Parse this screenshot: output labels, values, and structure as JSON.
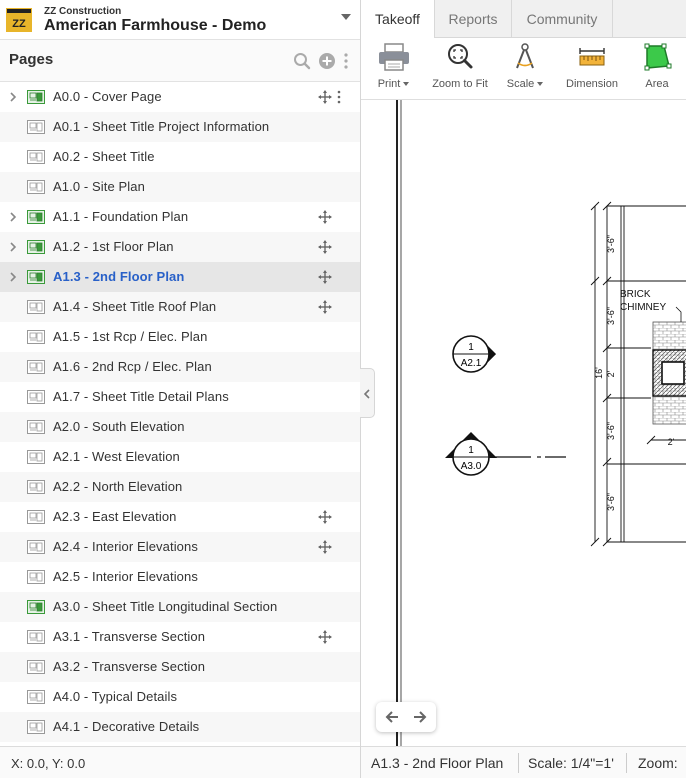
{
  "app": {
    "company": "ZZ Construction",
    "project": "American Farmhouse - Demo"
  },
  "pages_panel": {
    "title": "Pages",
    "items": [
      {
        "label": "A0.0 - Cover Page",
        "expandable": true,
        "icon": "sheet-green",
        "move": true,
        "more": true
      },
      {
        "label": "A0.1 - Sheet Title Project Information",
        "expandable": false,
        "icon": "sheet-gray"
      },
      {
        "label": "A0.2 - Sheet Title",
        "expandable": false,
        "icon": "sheet-gray"
      },
      {
        "label": "A1.0 - Site Plan",
        "expandable": false,
        "icon": "sheet-gray"
      },
      {
        "label": "A1.1 - Foundation Plan",
        "expandable": true,
        "icon": "sheet-green",
        "move": true
      },
      {
        "label": "A1.2 - 1st Floor Plan",
        "expandable": true,
        "icon": "sheet-green",
        "move": true
      },
      {
        "label": "A1.3 - 2nd Floor Plan",
        "expandable": true,
        "icon": "sheet-green",
        "move": true,
        "selected": true
      },
      {
        "label": "A1.4 - Sheet Title Roof Plan",
        "expandable": false,
        "icon": "sheet-gray",
        "move": true
      },
      {
        "label": "A1.5 - 1st Rcp / Elec. Plan",
        "expandable": false,
        "icon": "sheet-gray"
      },
      {
        "label": "A1.6 - 2nd Rcp / Elec. Plan",
        "expandable": false,
        "icon": "sheet-gray"
      },
      {
        "label": "A1.7 - Sheet Title Detail Plans",
        "expandable": false,
        "icon": "sheet-gray"
      },
      {
        "label": "A2.0 - South Elevation",
        "expandable": false,
        "icon": "sheet-gray"
      },
      {
        "label": "A2.1 - West Elevation",
        "expandable": false,
        "icon": "sheet-gray"
      },
      {
        "label": "A2.2 - North Elevation",
        "expandable": false,
        "icon": "sheet-gray"
      },
      {
        "label": "A2.3 - East Elevation",
        "expandable": false,
        "icon": "sheet-gray",
        "move": true
      },
      {
        "label": "A2.4 - Interior Elevations",
        "expandable": false,
        "icon": "sheet-gray",
        "move": true
      },
      {
        "label": "A2.5 - Interior Elevations",
        "expandable": false,
        "icon": "sheet-gray"
      },
      {
        "label": "A3.0 - Sheet Title Longitudinal Section",
        "expandable": false,
        "icon": "sheet-green"
      },
      {
        "label": "A3.1 - Transverse Section",
        "expandable": false,
        "icon": "sheet-gray",
        "move": true
      },
      {
        "label": "A3.2 - Transverse Section",
        "expandable": false,
        "icon": "sheet-gray"
      },
      {
        "label": "A4.0 - Typical Details",
        "expandable": false,
        "icon": "sheet-gray"
      },
      {
        "label": "A4.1 - Decorative Details",
        "expandable": false,
        "icon": "sheet-gray"
      }
    ]
  },
  "coords": "X: 0.0, Y: 0.0",
  "tabs": [
    {
      "label": "Takeoff",
      "active": true
    },
    {
      "label": "Reports",
      "active": false
    },
    {
      "label": "Community",
      "active": false
    }
  ],
  "toolbar": {
    "print": "Print",
    "zoom_fit": "Zoom to Fit",
    "scale": "Scale",
    "dimension": "Dimension",
    "area": "Area"
  },
  "drawing": {
    "callout_1_number": "1",
    "callout_1_sheet": "A2.1",
    "callout_2_number": "1",
    "callout_2_sheet": "A3.0",
    "brick_label_1": "BRICK",
    "brick_label_2": "CHIMNEY",
    "dim_1": "3'-6\"",
    "dim_2": "3'-6\"",
    "dim_3": "2'",
    "dim_4": "3'-6\"",
    "dim_5": "3'-6\"",
    "dim_total": "16'",
    "dim_h": "2'"
  },
  "status": {
    "page": "A1.3 - 2nd Floor Plan",
    "scale": "Scale: 1/4\"=1'",
    "zoom": "Zoom:"
  },
  "colors": {
    "accent": "#2860c8",
    "logo_yellow": "#e8b52a",
    "area_green": "#3cc94a",
    "sheet_green": "#3a9a3a"
  }
}
